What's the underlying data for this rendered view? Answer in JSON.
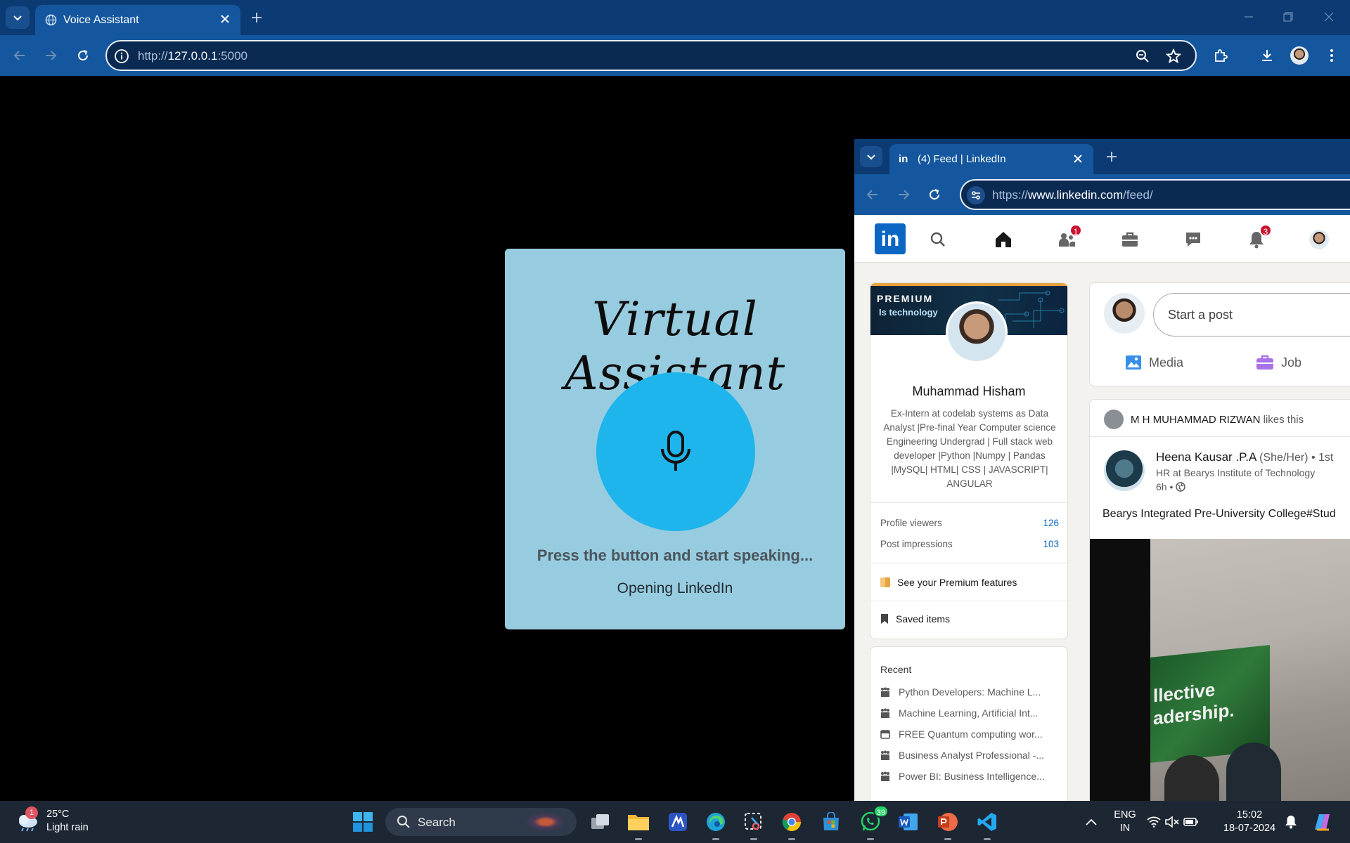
{
  "browser": {
    "tab_title": "Voice Assistant",
    "url_prefix": "http://",
    "url_host": "127.0.0.1",
    "url_rest": ":5000"
  },
  "assistant": {
    "title": "Virtual Assistant",
    "prompt": "Press the button and start speaking...",
    "status": "Opening LinkedIn"
  },
  "linkedin_window": {
    "tab_title": "(4) Feed | LinkedIn",
    "tab_icon_text": "in",
    "url_prefix": "https://",
    "url_host": "www.linkedin.com",
    "url_rest": "/feed/",
    "logo_text": "in",
    "badges": {
      "network": "1",
      "notifications": "3"
    },
    "profile": {
      "premium_label": "PREMIUM",
      "banner_text": "Is technology",
      "name": "Muhammad Hisham",
      "headline": "Ex-Intern at codelab systems as Data Analyst |Pre-final Year Computer science Engineering Undergrad | Full stack web developer |Python |Numpy | Pandas |MySQL| HTML| CSS | JAVASCRIPT| ANGULAR",
      "stats": [
        {
          "label": "Profile viewers",
          "value": "126"
        },
        {
          "label": "Post impressions",
          "value": "103"
        }
      ],
      "premium_features": "See your Premium features",
      "saved_items": "Saved items"
    },
    "recent": {
      "heading": "Recent",
      "items": [
        "Python Developers: Machine L...",
        "Machine Learning, Artificial Int...",
        "FREE Quantum computing wor...",
        "Business Analyst Professional -...",
        "Power BI: Business Intelligence..."
      ]
    },
    "composer": {
      "placeholder": "Start a post",
      "media": "Media",
      "job": "Job"
    },
    "feed_post": {
      "liker_name": "M H MUHAMMAD RIZWAN",
      "liker_suffix": "likes this",
      "author": "Heena Kausar .P.A",
      "author_meta": "(She/Her) • 1st",
      "role": "HR at Bearys Institute of Technology",
      "time": "6h •",
      "text": "Bearys Integrated Pre-University College#Stud",
      "image_text_1": "llective",
      "image_text_2": "adership."
    }
  },
  "taskbar": {
    "weather_badge": "1",
    "temperature": "25°C",
    "condition": "Light rain",
    "search_label": "Search",
    "whatsapp_count": "39",
    "lang_1": "ENG",
    "lang_2": "IN",
    "time": "15:02",
    "date": "18-07-2024"
  }
}
